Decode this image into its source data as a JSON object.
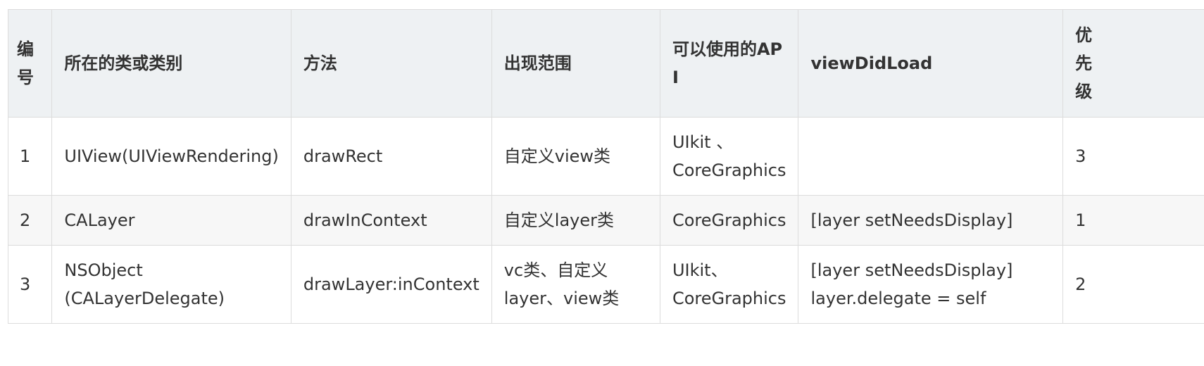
{
  "table": {
    "headers": [
      "编号",
      "所在的类或类别",
      "方法",
      "出现范围",
      "可以使用的API",
      "viewDidLoad",
      "优先级"
    ],
    "rows": [
      {
        "number": "1",
        "class": [
          "UIView(UIViewRendering)"
        ],
        "method": "drawRect",
        "scope": [
          "自定义view类"
        ],
        "api": [
          "UIkit 、",
          "CoreGraphics"
        ],
        "view_did_load": [],
        "priority": "3"
      },
      {
        "number": "2",
        "class": [
          "CALayer"
        ],
        "method": "drawInContext",
        "scope": [
          "自定义layer类"
        ],
        "api": [
          "CoreGraphics"
        ],
        "view_did_load": [
          "[layer setNeedsDisplay]"
        ],
        "priority": "1"
      },
      {
        "number": "3",
        "class": [
          "NSObject",
          "(CALayerDelegate)"
        ],
        "method": "drawLayer:inContext",
        "scope": [
          "vc类、自定义",
          "layer、view类"
        ],
        "api": [
          "UIkit、",
          "CoreGraphics"
        ],
        "view_did_load": [
          "[layer setNeedsDisplay]",
          "layer.delegate = self"
        ],
        "priority": "2"
      }
    ]
  }
}
